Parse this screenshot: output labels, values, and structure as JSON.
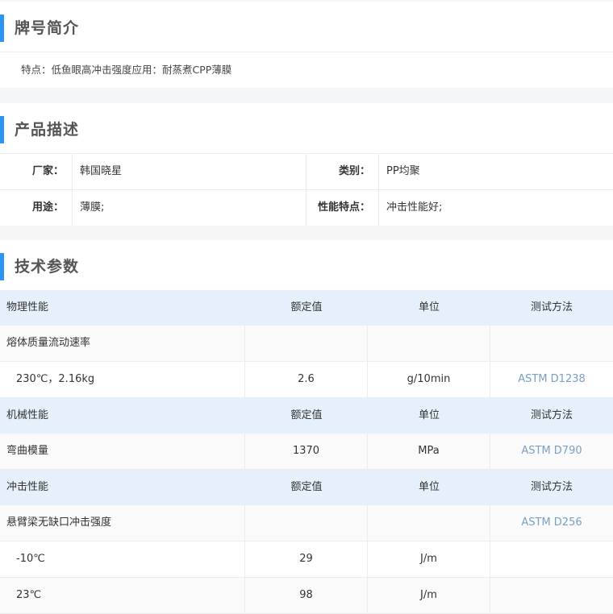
{
  "brand_intro": {
    "title": "牌号简介",
    "text": "特点：低鱼眼高冲击强度应用：耐蒸煮CPP薄膜"
  },
  "product_desc": {
    "title": "产品描述",
    "rows": [
      {
        "label1": "厂家：",
        "value1": "韩国晓星",
        "label2": "类别：",
        "value2": "PP均聚"
      },
      {
        "label1": "用途：",
        "value1": "薄膜;",
        "label2": "性能特点：",
        "value2": "冲击性能好;"
      }
    ]
  },
  "tech_params": {
    "title": "技术参数",
    "groups": [
      {
        "header": {
          "c1": "物理性能",
          "c2": "额定值",
          "c3": "单位",
          "c4": "测试方法"
        },
        "rows": [
          {
            "c1": "熔体质量流动速率",
            "c2": "",
            "c3": "",
            "c4": "",
            "indent": false
          },
          {
            "c1": "230℃，2.16kg",
            "c2": "2.6",
            "c3": "g/10min",
            "c4": "ASTM D1238",
            "indent": true
          }
        ]
      },
      {
        "header": {
          "c1": "机械性能",
          "c2": "额定值",
          "c3": "单位",
          "c4": "测试方法"
        },
        "rows": [
          {
            "c1": "弯曲模量",
            "c2": "1370",
            "c3": "MPa",
            "c4": "ASTM D790",
            "indent": false
          }
        ]
      },
      {
        "header": {
          "c1": "冲击性能",
          "c2": "额定值",
          "c3": "单位",
          "c4": "测试方法"
        },
        "rows": [
          {
            "c1": "悬臂梁无缺口冲击强度",
            "c2": "",
            "c3": "",
            "c4": "ASTM D256",
            "indent": false
          },
          {
            "c1": "-10℃",
            "c2": "29",
            "c3": "J/m",
            "c4": "",
            "indent": true
          },
          {
            "c1": "23℃",
            "c2": "98",
            "c3": "J/m",
            "c4": "",
            "indent": true
          }
        ]
      }
    ]
  },
  "colors": {
    "accent": "#2a95f5",
    "header_bg": "#e5f0fb",
    "link": "#7a9ec2"
  }
}
